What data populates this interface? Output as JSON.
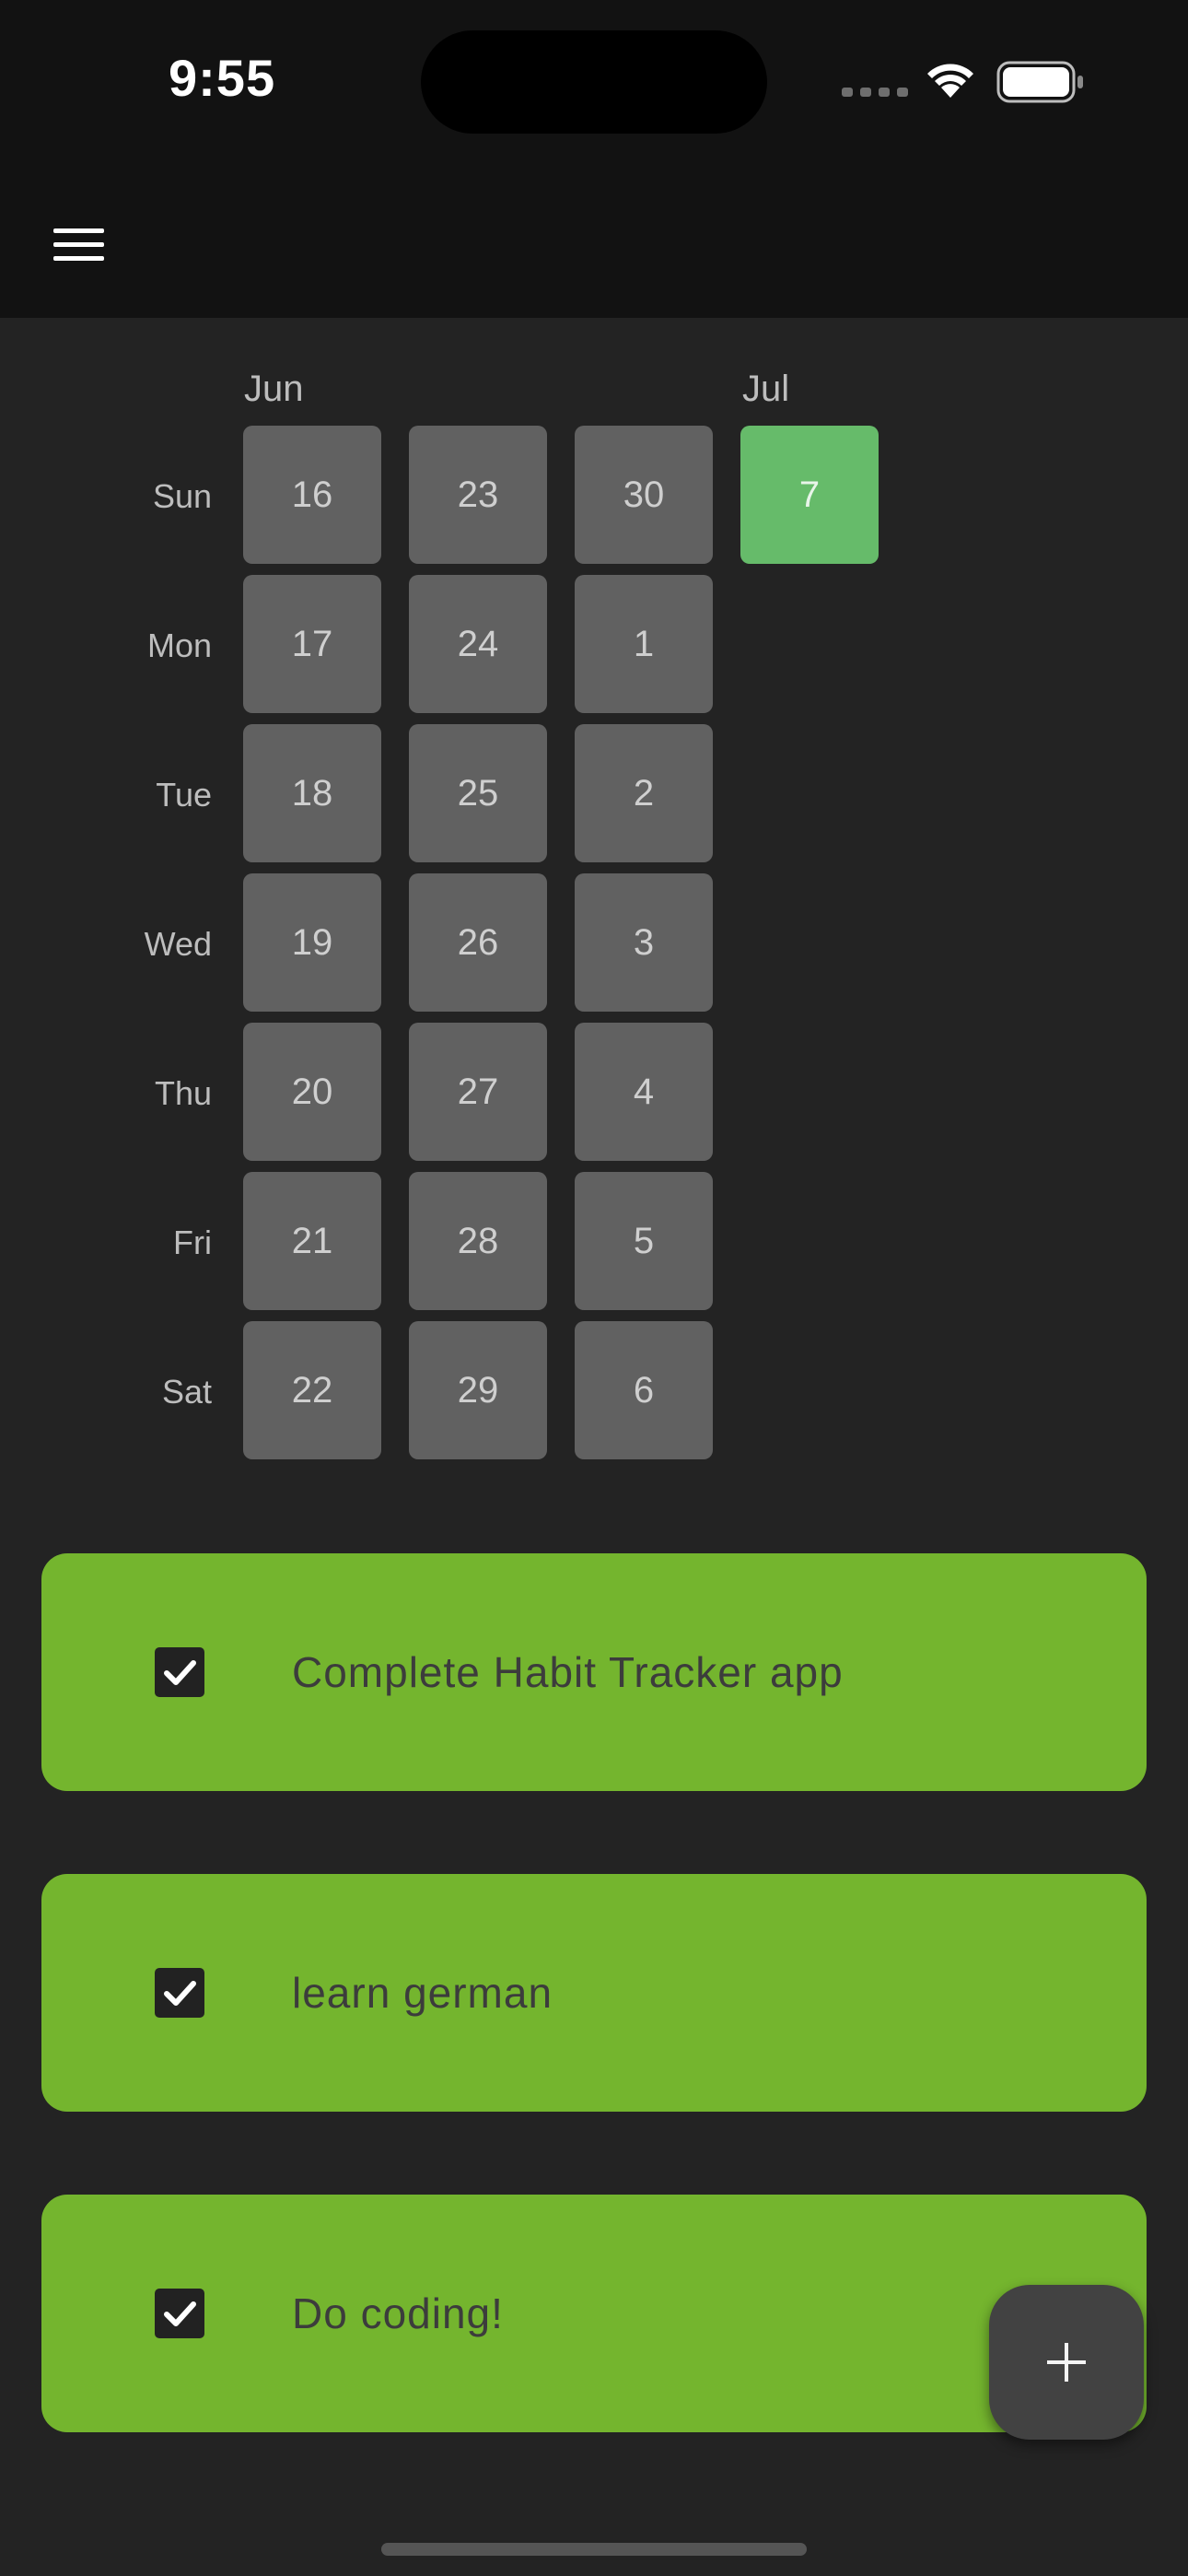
{
  "status_bar": {
    "time": "9:55",
    "icons": [
      "signal-icon",
      "wifi-icon",
      "battery-icon"
    ]
  },
  "app_bar": {
    "menu_icon": "hamburger-menu-icon"
  },
  "heatmap": {
    "months": [
      "Jun",
      "Jul"
    ],
    "weekdays": [
      "Sun",
      "Mon",
      "Tue",
      "Wed",
      "Thu",
      "Fri",
      "Sat"
    ],
    "weeks": [
      {
        "days": [
          "16",
          "17",
          "18",
          "19",
          "20",
          "21",
          "22"
        ],
        "completed": [
          false,
          false,
          false,
          false,
          false,
          false,
          false
        ]
      },
      {
        "days": [
          "23",
          "24",
          "25",
          "26",
          "27",
          "28",
          "29"
        ],
        "completed": [
          false,
          false,
          false,
          false,
          false,
          false,
          false
        ]
      },
      {
        "days": [
          "30",
          "1",
          "2",
          "3",
          "4",
          "5",
          "6"
        ],
        "completed": [
          false,
          false,
          false,
          false,
          false,
          false,
          false
        ]
      },
      {
        "days": [
          "7"
        ],
        "completed": [
          true
        ]
      }
    ],
    "colors": {
      "empty": "#616161",
      "done": "#66bb6a"
    }
  },
  "habits": [
    {
      "name": "Complete Habit Tracker app",
      "checked": true
    },
    {
      "name": "learn german",
      "checked": true
    },
    {
      "name": "Do coding!",
      "checked": true
    }
  ],
  "colors": {
    "habit_done": "#74b52e",
    "background": "#232323",
    "bar": "#121212"
  },
  "fab": {
    "icon": "plus-icon"
  }
}
